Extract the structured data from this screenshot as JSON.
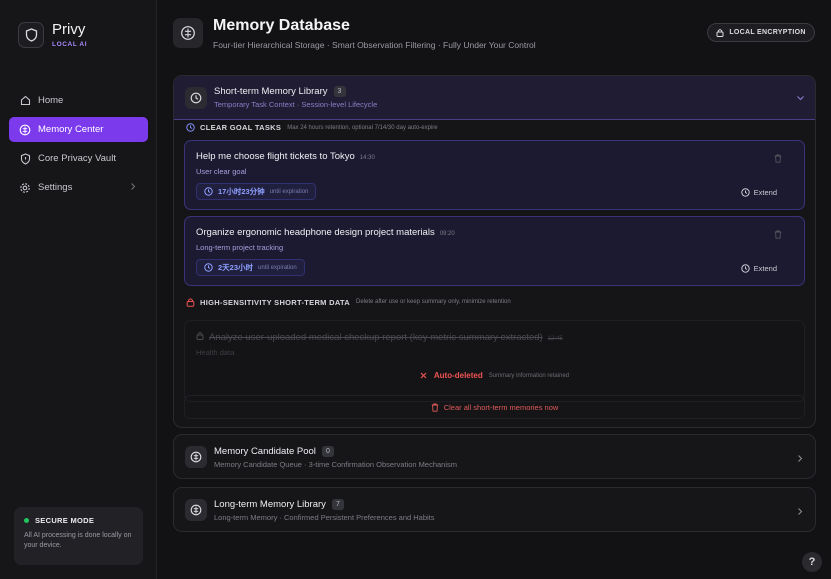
{
  "brand": {
    "name": "Privy",
    "subtitle": "LOCAL AI"
  },
  "nav": [
    {
      "label": "Home",
      "icon": "home-icon"
    },
    {
      "label": "Memory Center",
      "icon": "brain-icon",
      "active": true
    },
    {
      "label": "Core Privacy Vault",
      "icon": "shield-icon"
    },
    {
      "label": "Settings",
      "icon": "gear-icon"
    }
  ],
  "secure": {
    "title": "SECURE MODE",
    "text": "All AI processing is done locally on your device."
  },
  "header": {
    "title": "Memory Database",
    "subtitle": "Four-tier Hierarchical Storage · Smart Observation Filtering · Fully Under Your Control",
    "badge": "LOCAL ENCRYPTION"
  },
  "short_term": {
    "title": "Short-term Memory Library",
    "count": "3",
    "subtitle": "Temporary Task Context · Session-level Lifecycle",
    "clear_group": {
      "label": "CLEAR GOAL TASKS",
      "hint": "Max 24 hours retention, optional 7/14/30 day auto-expire",
      "tasks": [
        {
          "title": "Help me choose flight tickets to Tokyo",
          "time": "14:30",
          "subtitle": "User clear goal",
          "remaining": "17小时23分钟",
          "suffix": "until expiration",
          "extend": "Extend"
        },
        {
          "title": "Organize ergonomic headphone design project materials",
          "time": "09:20",
          "subtitle": "Long-term project tracking",
          "remaining": "2天23小时",
          "suffix": "until expiration",
          "extend": "Extend"
        }
      ]
    },
    "sensitive_group": {
      "label": "HIGH-SENSITIVITY SHORT-TERM DATA",
      "hint": "Delete after use or keep summary only, minimize retention",
      "item": {
        "title": "Analyze user-uploaded medical checkup report (key metric summary extracted)",
        "time": "12:45",
        "subtitle": "Health data",
        "status": "Auto-deleted",
        "note": "Summary information retained"
      }
    },
    "clear_all": "Clear all short-term memories now"
  },
  "candidate_pool": {
    "title": "Memory Candidate Pool",
    "count": "0",
    "subtitle": "Memory Candidate Queue · 3-time Confirmation Observation Mechanism"
  },
  "long_term": {
    "title": "Long-term Memory Library",
    "count": "7",
    "subtitle": "Long-term Memory · Confirmed Persistent Preferences and Habits"
  },
  "help": "?",
  "colors": {
    "accent": "#7c3aed",
    "danger": "#f05252",
    "success": "#22c55e",
    "timer": "#8ea0ff"
  }
}
